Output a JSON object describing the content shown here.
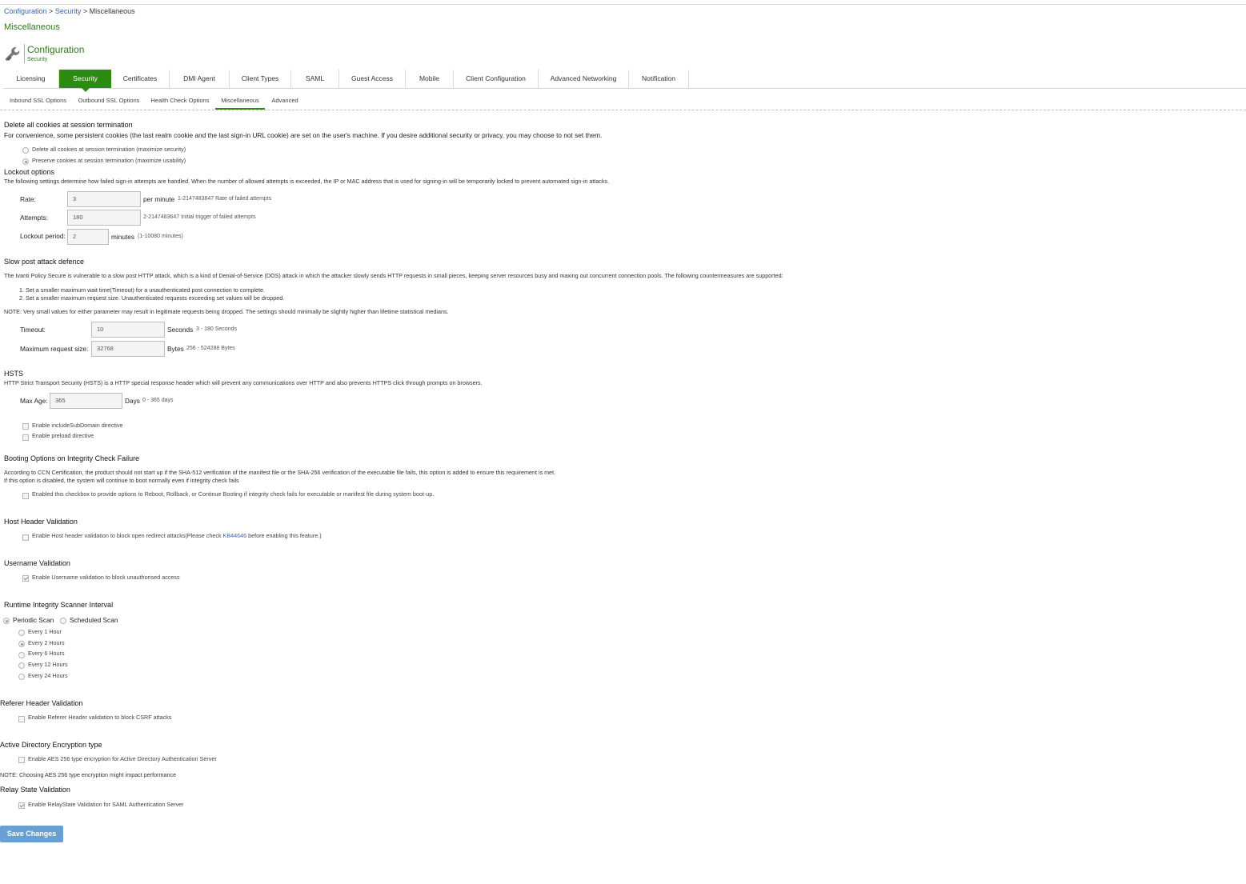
{
  "breadcrumb": {
    "item1": "Configuration",
    "sep1": " > ",
    "item2": "Security",
    "sep2": " > ",
    "current": "Miscellaneous"
  },
  "page_heading": "Miscellaneous",
  "config_header": {
    "title": "Configuration",
    "subtitle": "Security",
    "icon": "wrench-icon"
  },
  "tabs": [
    "Licensing",
    "Security",
    "Certificates",
    "DMI Agent",
    "Client Types",
    "SAML",
    "Guest Access",
    "Mobile",
    "Client Configuration",
    "Advanced Networking",
    "Notification"
  ],
  "active_tab": "Security",
  "subtabs": [
    "Inbound SSL Options",
    "Outbound SSL Options",
    "Health Check Options",
    "Miscellaneous",
    "Advanced"
  ],
  "active_subtab": "Miscellaneous",
  "cookies": {
    "heading": "Delete all cookies at session termination",
    "description": "For convenience, some persistent cookies (the last realm cookie and the last sign-in URL cookie) are set on the user's machine. If you desire additional security or privacy, you may choose to not set them.",
    "options": [
      "Delete all cookies at session termination (maximize security)",
      "Preserve cookies at session termination (maximize usability)"
    ],
    "selected": 1
  },
  "lockout": {
    "heading": "Lockout options",
    "description": "The following settings determine how failed sign-in attempts are handled. When the number of allowed attempts is exceeded, the IP or MAC address that is used for signing-in will be temporarily locked to prevent automated sign-in attacks.",
    "rate": {
      "label": "Rate:",
      "value": "3",
      "unit": "per minute",
      "hint": "1-2147483647 Rate of failed attempts"
    },
    "attempts": {
      "label": "Attempts:",
      "value": "180",
      "hint": "2-2147483647 Initial trigger of failed attempts"
    },
    "period": {
      "label": "Lockout period:",
      "value": "2",
      "unit": "minutes",
      "hint": "(1-10080 minutes)"
    }
  },
  "slowpost": {
    "heading": "Slow post attack defence",
    "description": "The Ivanti Policy Secure is vulnerable to a slow post HTTP attack, which is a kind of Denial-of-Service (DOS) attack in which the attacker slowly sends HTTP requests in small pieces, keeping server resources busy and maxing out concurrent connection pools. The following countermeasures are supported:",
    "items": [
      "1. Set a smaller maximum wait time(Timeout) for a unauthenticated post connection to complete.",
      "2. Set a smaller maximum request size. Unauthenticated requests exceeding set values will be dropped."
    ],
    "note": "NOTE: Very small values for either parameter may result in legitimate requests being dropped. The settings should minimally be slightly higher than lifetime statistical medians.",
    "timeout": {
      "label": "Timeout:",
      "value": "10",
      "unit": "Seconds",
      "hint": "3 - 180 Seconds"
    },
    "maxsize": {
      "label": "Maximum request size:",
      "value": "32768",
      "unit": "Bytes",
      "hint": "256 - 524288 Bytes"
    }
  },
  "hsts": {
    "heading": "HSTS",
    "description": "HTTP Strict Transport Security (HSTS) is a HTTP special response header which will prevent any communications over HTTP and also prevents HTTPS click through prompts on browsers.",
    "maxage": {
      "label": "Max Age:",
      "value": "365",
      "unit": "Days",
      "hint": "0 - 365 days"
    },
    "options": [
      {
        "label": "Enable includeSubDomain directive",
        "checked": false
      },
      {
        "label": "Enable preload directive",
        "checked": false
      }
    ]
  },
  "booting": {
    "heading": "Booting Options on Integrity Check Failure",
    "description1": "According to CCN Certification, the product should not start up if the SHA-512 verification of the manifest file or the SHA-256 verification of the executable file fails, this option is added to ensure this requirement is met.",
    "description2": "If this option is disabled, the system will continue to boot normally even if integrity check fails",
    "option": {
      "label": "Enabled this checkbox to provide options to Reboot, Rollback, or Continue Booting if integrity check fails for executable or manifest file during system boot-up.",
      "checked": false
    }
  },
  "hostheader": {
    "heading": "Host Header Validation",
    "option": {
      "label": "Enable Host header validation to block open redirect attacks",
      "checked": false
    },
    "hint_prefix": "(Please check ",
    "hint_link": "KB44646",
    "hint_suffix": " before enabling this feature.)"
  },
  "username": {
    "heading": "Username Validation",
    "option": {
      "label": "Enable Username validation to block unauthorised access",
      "checked": true
    }
  },
  "runtime": {
    "heading": "Runtime Integrity Scanner Interval",
    "modes": [
      "Periodic Scan",
      "Scheduled Scan"
    ],
    "mode_selected": 0,
    "intervals": [
      "Every 1 Hour",
      "Every 2 Hours",
      "Every 6 Hours",
      "Every 12 Hours",
      "Every 24 Hours"
    ],
    "interval_selected": 1
  },
  "referer": {
    "heading": "Referer Header Validation",
    "option": {
      "label": "Enable Referer Header validation to block CSRF attacks",
      "checked": false
    }
  },
  "ad": {
    "heading": "Active Directory Encryption type",
    "option": {
      "label": "Enable AES 256 type encryption for Active Directory Authentication Server",
      "checked": false
    },
    "note": "NOTE: Choosing AES 256 type encryption might impact performance"
  },
  "relay": {
    "heading": "Relay State Validation",
    "option": {
      "label": "Enable RelayState Validation for SAML Authentication Server",
      "checked": true
    }
  },
  "save_button": "Save Changes",
  "colors": {
    "accent_green": "#2e8b12",
    "link_blue": "#3a63a8",
    "button_blue": "#6a9fd3"
  }
}
